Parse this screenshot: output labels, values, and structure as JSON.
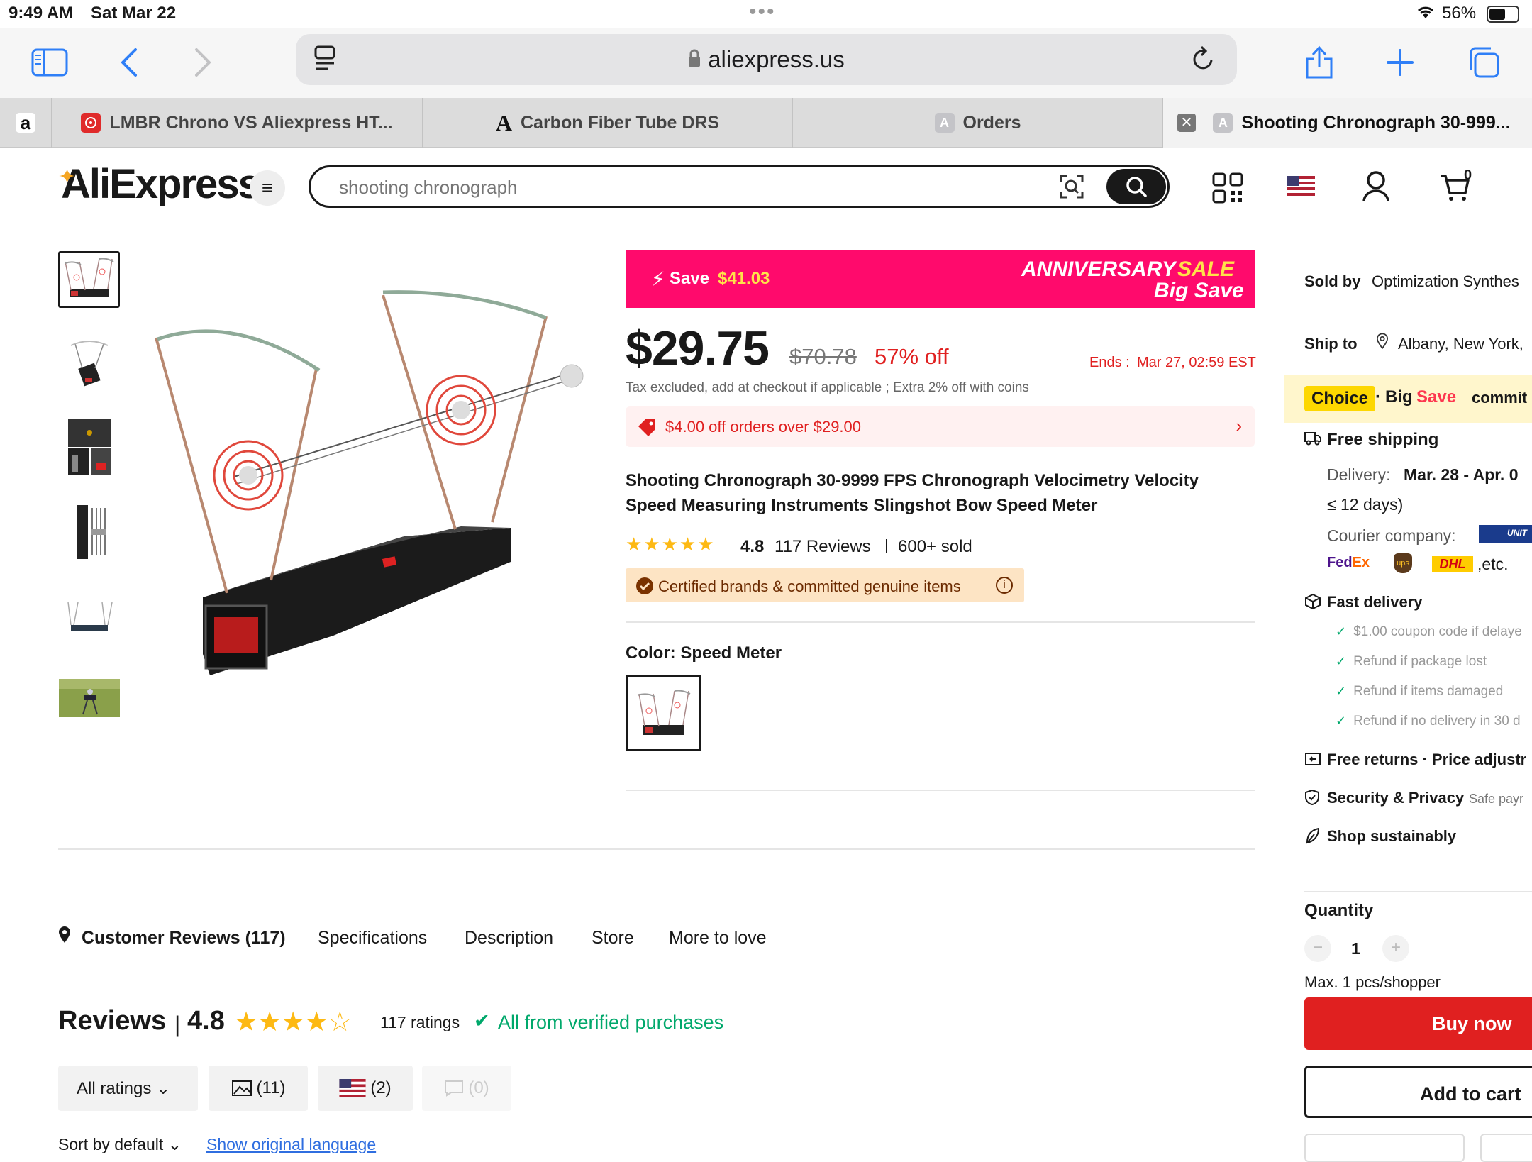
{
  "status_bar": {
    "time": "9:49 AM",
    "date": "Sat Mar 22",
    "battery": "56%"
  },
  "browser": {
    "url": "aliexpress.us",
    "tabs": [
      {
        "label": "",
        "favicon": "a"
      },
      {
        "label": "LMBR Chrono VS Aliexpress HT...",
        "favicon": "target"
      },
      {
        "label": "Carbon Fiber Tube DRS",
        "favicon": "A"
      },
      {
        "label": "Orders",
        "favicon": "A"
      },
      {
        "label": "Shooting Chronograph 30-999...",
        "favicon": "A"
      }
    ]
  },
  "header": {
    "logo": "AliExpress",
    "search_placeholder": "shooting chronograph",
    "cart_count": "0"
  },
  "banner": {
    "save_label": "Save",
    "save_amount": "$41.03",
    "sale_word1": "ANNIVERSARY",
    "sale_word2": "SALE",
    "sub": "Big Save"
  },
  "price": {
    "current": "$29.75",
    "original": "$70.78",
    "discount": "57% off",
    "ends_label": "Ends :",
    "ends_value": "Mar 27, 02:59 EST",
    "tax_note": "Tax excluded, add at checkout if applicable ; Extra 2% off with coins",
    "coupon": "$4.00 off orders over $29.00"
  },
  "product": {
    "title": "Shooting Chronograph 30-9999 FPS Chronograph Velocimetry Velocity Speed Measuring Instruments Slingshot Bow Speed Meter",
    "rating": "4.8",
    "reviews": "117 Reviews",
    "sold": "600+ sold",
    "certified": "Certified brands & committed genuine items",
    "color_label": "Color: Speed Meter"
  },
  "section_tabs": [
    "Customer Reviews (117)",
    "Specifications",
    "Description",
    "Store",
    "More to love"
  ],
  "reviews": {
    "title": "Reviews",
    "rating": "4.8",
    "count": "117 ratings",
    "verified": "All from verified purchases",
    "filters": [
      "All ratings",
      "(11)",
      "(2)",
      "(0)"
    ],
    "sort": "Sort by default",
    "show_original": "Show original language"
  },
  "sidebar": {
    "sold_by_label": "Sold by",
    "sold_by_value": "Optimization Synthes",
    "ship_to_label": "Ship to",
    "ship_to_value": "Albany, New York,",
    "choice": "Choice",
    "big": "Big",
    "save": "Save",
    "commit": "commit",
    "free_shipping": "Free shipping",
    "delivery_label": "Delivery:",
    "delivery_value": "Mar. 28 - Apr. 0",
    "delivery_days": "≤ 12 days)",
    "courier_label": "Courier company:",
    "courier_etc": ",etc.",
    "fast_delivery": "Fast delivery",
    "guarantees": [
      "$1.00 coupon code if delaye",
      "Refund if package lost",
      "Refund if items damaged",
      "Refund if no delivery in 30 d"
    ],
    "free_returns": "Free returns · Price adjustr",
    "security": "Security & Privacy",
    "security_sub": "Safe payr",
    "sustain": "Shop sustainably",
    "quantity_label": "Quantity",
    "quantity_value": "1",
    "max_note": "Max. 1 pcs/shopper",
    "buy_now": "Buy now",
    "add_to_cart": "Add to cart"
  },
  "colors": {
    "accent_red": "#fd384f",
    "banner_pink": "#ff0a6c",
    "buy_red": "#e02020",
    "safari_blue": "#2f7ff7"
  }
}
